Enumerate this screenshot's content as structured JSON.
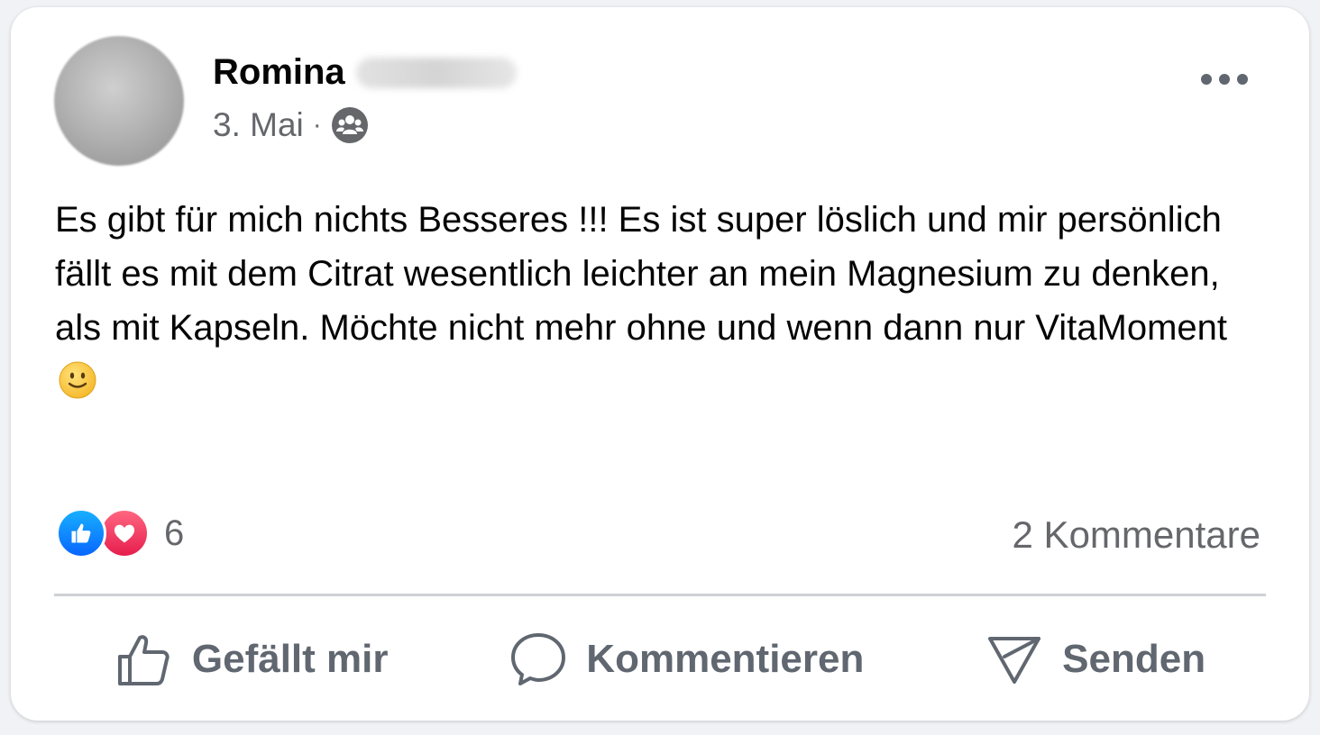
{
  "post": {
    "author": {
      "first_name": "Romina",
      "avatar_icon": "user-avatar-blurred"
    },
    "date": "3. Mai",
    "separator": "·",
    "audience_icon": "group-audience-icon",
    "text": "Es gibt für mich nichts Besseres !!! Es ist super löslich und mir persönlich fällt es mit dem Citrat wesentlich leichter an mein Magnesium zu denken, als mit Kapseln. Möchte nicht mehr ohne und wenn dann nur VitaMoment",
    "text_emoji": "slightly-smiling-face"
  },
  "engagement": {
    "reactions": [
      "like",
      "love"
    ],
    "reaction_count": "6",
    "comments_label": "2 Kommentare"
  },
  "actions": {
    "like_label": "Gefällt mir",
    "comment_label": "Kommentieren",
    "send_label": "Senden"
  },
  "colors": {
    "like_blue": "#0866ff",
    "love_red": "#e61e4d",
    "secondary_text": "#65676b",
    "action_text": "#606770"
  }
}
